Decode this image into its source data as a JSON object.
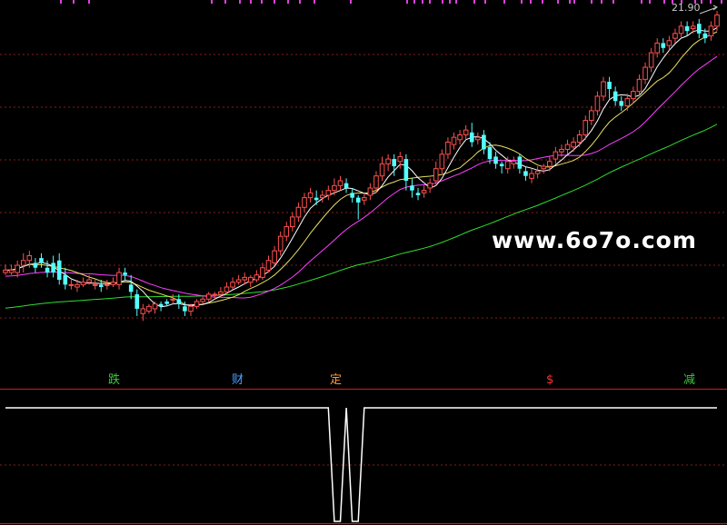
{
  "watermark": "www.6o7o.com",
  "price_label": "21.90",
  "markers": [
    {
      "text": "跌",
      "color": "#3ec83e"
    },
    {
      "text": "财",
      "color": "#4aa0ff"
    },
    {
      "text": "定",
      "color": "#ff9933"
    },
    {
      "text": "$",
      "color": "#ff3333"
    },
    {
      "text": "减",
      "color": "#3ec83e"
    }
  ],
  "colors": {
    "up": "#ff5050",
    "down": "#54ffff",
    "ma_short": "#ffffff",
    "ma_mid": "#e8e060",
    "ma_long": "#ff40ff",
    "ma_trend": "#30dd30",
    "grid": "#8a1c1c",
    "indicator": "#ffffff"
  },
  "chart_data": {
    "type": "candlestick",
    "title": "",
    "price_range": [
      13.2,
      22.0
    ],
    "candles": [
      [
        15.5,
        15.56,
        15.7,
        15.44
      ],
      [
        15.5,
        15.56,
        15.7,
        15.44
      ],
      [
        15.5,
        15.68,
        15.8,
        15.38
      ],
      [
        15.68,
        15.8,
        15.98,
        15.5
      ],
      [
        15.8,
        15.92,
        16.04,
        15.62
      ],
      [
        15.74,
        15.62,
        15.86,
        15.5
      ],
      [
        15.86,
        15.74,
        15.98,
        15.62
      ],
      [
        15.62,
        15.5,
        15.8,
        15.38
      ],
      [
        15.74,
        15.5,
        15.92,
        15.38
      ],
      [
        15.8,
        15.32,
        15.98,
        15.2
      ],
      [
        15.44,
        15.2,
        15.62,
        15.08
      ],
      [
        15.2,
        15.2,
        15.32,
        15.08
      ],
      [
        15.14,
        15.2,
        15.32,
        15.02
      ],
      [
        15.2,
        15.26,
        15.38,
        15.14
      ],
      [
        15.26,
        15.32,
        15.44,
        15.2
      ],
      [
        15.2,
        15.2,
        15.32,
        15.08
      ],
      [
        15.2,
        15.14,
        15.32,
        15.02
      ],
      [
        15.2,
        15.2,
        15.32,
        15.08
      ],
      [
        15.2,
        15.26,
        15.38,
        15.14
      ],
      [
        15.2,
        15.5,
        15.62,
        15.08
      ],
      [
        15.5,
        15.44,
        15.62,
        15.32
      ],
      [
        15.2,
        15.02,
        15.44,
        14.84
      ],
      [
        14.96,
        14.6,
        15.08,
        14.42
      ],
      [
        14.48,
        14.6,
        14.72,
        14.3
      ],
      [
        14.54,
        14.66,
        14.72,
        14.48
      ],
      [
        14.6,
        14.72,
        14.78,
        14.48
      ],
      [
        14.72,
        14.66,
        14.78,
        14.54
      ],
      [
        14.78,
        14.72,
        14.84,
        14.66
      ],
      [
        14.84,
        14.84,
        14.96,
        14.72
      ],
      [
        14.84,
        14.72,
        14.96,
        14.6
      ],
      [
        14.66,
        14.54,
        14.78,
        14.42
      ],
      [
        14.54,
        14.66,
        14.72,
        14.42
      ],
      [
        14.66,
        14.78,
        14.84,
        14.6
      ],
      [
        14.78,
        14.84,
        14.9,
        14.72
      ],
      [
        14.84,
        14.96,
        15.02,
        14.78
      ],
      [
        14.96,
        14.96,
        15.02,
        14.84
      ],
      [
        14.96,
        15.02,
        15.14,
        14.9
      ],
      [
        15.02,
        15.14,
        15.26,
        14.96
      ],
      [
        15.14,
        15.26,
        15.38,
        15.08
      ],
      [
        15.26,
        15.32,
        15.44,
        15.2
      ],
      [
        15.32,
        15.38,
        15.5,
        15.2
      ],
      [
        15.26,
        15.38,
        15.44,
        15.14
      ],
      [
        15.32,
        15.44,
        15.56,
        15.26
      ],
      [
        15.38,
        15.62,
        15.74,
        15.32
      ],
      [
        15.56,
        15.8,
        15.92,
        15.5
      ],
      [
        15.74,
        16.04,
        16.16,
        15.68
      ],
      [
        16.04,
        16.4,
        16.52,
        15.92
      ],
      [
        16.4,
        16.64,
        16.76,
        16.28
      ],
      [
        16.64,
        16.88,
        17.0,
        16.52
      ],
      [
        16.88,
        17.12,
        17.24,
        16.76
      ],
      [
        17.12,
        17.36,
        17.48,
        17.0
      ],
      [
        17.36,
        17.48,
        17.6,
        17.24
      ],
      [
        17.36,
        17.3,
        17.54,
        17.18
      ],
      [
        17.36,
        17.42,
        17.54,
        17.24
      ],
      [
        17.42,
        17.54,
        17.66,
        17.3
      ],
      [
        17.54,
        17.66,
        17.84,
        17.42
      ],
      [
        17.66,
        17.78,
        17.9,
        17.54
      ],
      [
        17.72,
        17.6,
        17.84,
        17.48
      ],
      [
        17.48,
        17.36,
        17.6,
        17.24
      ],
      [
        17.36,
        17.24,
        17.42,
        16.82
      ],
      [
        17.3,
        17.36,
        17.48,
        17.18
      ],
      [
        17.42,
        17.6,
        17.72,
        17.3
      ],
      [
        17.6,
        17.9,
        18.02,
        17.48
      ],
      [
        17.9,
        18.2,
        18.38,
        17.78
      ],
      [
        18.2,
        18.32,
        18.44,
        18.02
      ],
      [
        18.32,
        18.14,
        18.44,
        17.9
      ],
      [
        18.26,
        18.38,
        18.5,
        18.08
      ],
      [
        18.32,
        17.78,
        18.44,
        17.54
      ],
      [
        17.66,
        17.54,
        17.84,
        17.36
      ],
      [
        17.48,
        17.42,
        17.6,
        17.3
      ],
      [
        17.48,
        17.54,
        17.66,
        17.36
      ],
      [
        17.6,
        17.72,
        17.84,
        17.48
      ],
      [
        17.78,
        18.08,
        18.26,
        17.66
      ],
      [
        18.08,
        18.44,
        18.56,
        17.96
      ],
      [
        18.44,
        18.74,
        18.86,
        18.32
      ],
      [
        18.68,
        18.86,
        18.98,
        18.56
      ],
      [
        18.8,
        18.92,
        19.04,
        18.68
      ],
      [
        18.92,
        19.04,
        19.16,
        18.8
      ],
      [
        18.98,
        18.74,
        19.22,
        18.62
      ],
      [
        18.8,
        18.86,
        18.98,
        18.68
      ],
      [
        18.92,
        18.56,
        19.04,
        18.44
      ],
      [
        18.62,
        18.32,
        18.74,
        18.2
      ],
      [
        18.38,
        18.2,
        18.5,
        18.08
      ],
      [
        18.2,
        18.14,
        18.26,
        17.96
      ],
      [
        18.08,
        18.26,
        18.38,
        17.96
      ],
      [
        18.2,
        18.26,
        18.38,
        18.08
      ],
      [
        18.38,
        18.08,
        18.44,
        17.96
      ],
      [
        18.02,
        17.9,
        18.14,
        17.78
      ],
      [
        17.84,
        17.96,
        18.08,
        17.72
      ],
      [
        17.96,
        18.02,
        18.14,
        17.84
      ],
      [
        18.08,
        18.14,
        18.2,
        17.96
      ],
      [
        18.14,
        18.26,
        18.38,
        18.02
      ],
      [
        18.32,
        18.5,
        18.62,
        18.2
      ],
      [
        18.5,
        18.56,
        18.68,
        18.38
      ],
      [
        18.56,
        18.68,
        18.8,
        18.44
      ],
      [
        18.62,
        18.74,
        18.86,
        18.5
      ],
      [
        18.74,
        18.92,
        19.04,
        18.62
      ],
      [
        18.92,
        19.28,
        19.4,
        18.8
      ],
      [
        19.28,
        19.52,
        19.64,
        19.16
      ],
      [
        19.52,
        19.88,
        20.0,
        19.4
      ],
      [
        19.88,
        20.24,
        20.36,
        19.76
      ],
      [
        20.24,
        20.06,
        20.36,
        19.82
      ],
      [
        20.0,
        19.76,
        20.12,
        19.64
      ],
      [
        19.76,
        19.64,
        19.88,
        19.52
      ],
      [
        19.64,
        19.82,
        19.94,
        19.52
      ],
      [
        19.82,
        20.0,
        20.12,
        19.7
      ],
      [
        20.0,
        20.3,
        20.42,
        19.88
      ],
      [
        20.3,
        20.6,
        20.72,
        20.18
      ],
      [
        20.6,
        20.96,
        21.08,
        20.48
      ],
      [
        20.96,
        21.2,
        21.32,
        20.84
      ],
      [
        21.2,
        21.08,
        21.32,
        20.96
      ],
      [
        21.14,
        21.26,
        21.38,
        21.02
      ],
      [
        21.32,
        21.44,
        21.56,
        21.2
      ],
      [
        21.44,
        21.62,
        21.74,
        21.32
      ],
      [
        21.62,
        21.5,
        21.74,
        21.38
      ],
      [
        21.56,
        21.62,
        21.74,
        21.44
      ],
      [
        21.68,
        21.44,
        21.8,
        21.32
      ],
      [
        21.44,
        21.32,
        21.56,
        21.2
      ],
      [
        21.38,
        21.62,
        21.74,
        21.26
      ],
      [
        21.62,
        21.9,
        22.0,
        21.5
      ]
    ],
    "ma_periods": [
      5,
      10,
      20,
      60
    ],
    "indicator": {
      "type": "line",
      "values": [
        1,
        1,
        1,
        1,
        1,
        1,
        1,
        1,
        1,
        1,
        1,
        1,
        1,
        1,
        1,
        1,
        1,
        1,
        1,
        1,
        1,
        1,
        1,
        1,
        1,
        1,
        1,
        1,
        1,
        1,
        1,
        1,
        1,
        1,
        1,
        1,
        1,
        1,
        1,
        1,
        1,
        1,
        1,
        1,
        1,
        1,
        1,
        1,
        1,
        1,
        1,
        1,
        1,
        1,
        1,
        0,
        0,
        1,
        0,
        0,
        1,
        1,
        1,
        1,
        1,
        1,
        1,
        1,
        1,
        1,
        1,
        1,
        1,
        1,
        1,
        1,
        1,
        1,
        1,
        1,
        1,
        1,
        1,
        1,
        1,
        1,
        1,
        1,
        1,
        1,
        1,
        1,
        1,
        1,
        1,
        1,
        1,
        1,
        1,
        1,
        1,
        1,
        1,
        1,
        1,
        1,
        1,
        1,
        1,
        1,
        1,
        1,
        1,
        1,
        1,
        1,
        1,
        1,
        1,
        1
      ]
    }
  }
}
